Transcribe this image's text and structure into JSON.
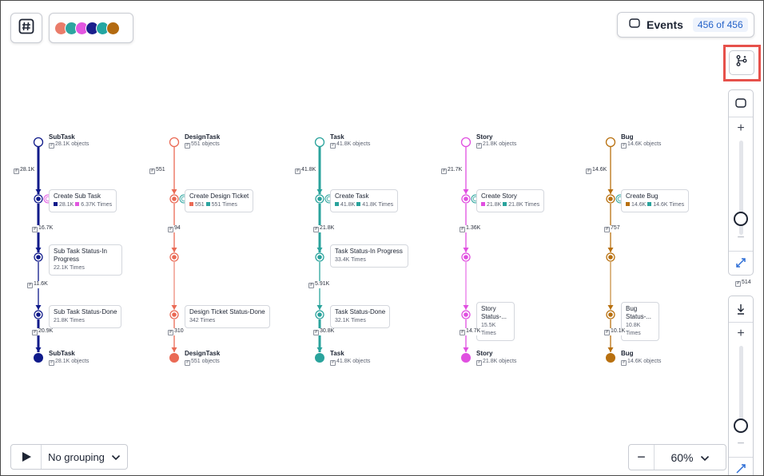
{
  "toolbar": {
    "hash_icon": "hash-icon",
    "palette_colors": [
      "#ea7c6a",
      "#2da5a0",
      "#e256e0",
      "#1a1f8c",
      "#23a6a2",
      "#b36a10"
    ],
    "events_label": "Events",
    "events_count": "456 of 456"
  },
  "side": {
    "count_label": "514"
  },
  "bottom": {
    "grouping_label": "No grouping",
    "zoom_value": "60%",
    "zoom_minus": "−"
  },
  "columns": [
    {
      "name": "SubTask",
      "color": "#0f1a8a",
      "secondary": "#e256e0",
      "start_title": "SubTask",
      "start_sub": "28.1K objects",
      "end_title": "SubTask",
      "end_sub": "28.1K objects",
      "e1": "28.1K",
      "create_title": "Create Sub Task",
      "create_a": "28.1K",
      "create_b": "6.37K Times",
      "e2": "16.7K",
      "s1_title": "Sub Task Status-In Progress",
      "s1_meta": "22.1K Times",
      "e3": "11.6K",
      "s2_title": "Sub Task Status-Done",
      "s2_meta": "21.8K Times",
      "e4": "20.9K"
    },
    {
      "name": "DesignTask",
      "color": "#ea6a55",
      "secondary": "#2da5a0",
      "start_title": "DesignTask",
      "start_sub": "551 objects",
      "end_title": "DesignTask",
      "end_sub": "551 objects",
      "e1": "551",
      "create_title": "Create Design Ticket",
      "create_a": "551",
      "create_b": "551 Times",
      "e2": "94",
      "s1_title": "Design Ticket Status-Done",
      "s1_meta": "342 Times",
      "e4": "310"
    },
    {
      "name": "Task",
      "color": "#2aa39c",
      "secondary": "#2aa39c",
      "start_title": "Task",
      "start_sub": "41.8K objects",
      "end_title": "Task",
      "end_sub": "41.8K objects",
      "e1": "41.8K",
      "create_title": "Create Task",
      "create_a": "41.8K",
      "create_b": "41.8K Times",
      "e2": "21.8K",
      "s1_title": "Task Status-In Progress",
      "s1_meta": "33.4K Times",
      "e3": "5.91K",
      "s2_title": "Task Status-Done",
      "s2_meta": "32.1K Times",
      "e4": "30.8K"
    },
    {
      "name": "Story",
      "color": "#e04fe0",
      "secondary": "#2aa39c",
      "start_title": "Story",
      "start_sub": "21.8K objects",
      "end_title": "Story",
      "end_sub": "21.8K objects",
      "e1": "21.7K",
      "create_title": "Create Story",
      "create_a": "21.8K",
      "create_b": "21.8K Times",
      "e2": "1.36K",
      "s1_title": "Story Status-...",
      "s1_meta": "15.5K Times",
      "e4": "14.7K"
    },
    {
      "name": "Bug",
      "color": "#b8700f",
      "secondary": "#2aa39c",
      "start_title": "Bug",
      "start_sub": "14.6K objects",
      "end_title": "Bug",
      "end_sub": "14.6K objects",
      "e1": "14.6K",
      "create_title": "Create Bug",
      "create_a": "14.6K",
      "create_b": "14.6K Times",
      "e2": "757",
      "s1_title": "Bug Status-...",
      "s1_meta": "10.8K Times",
      "e4": "10.1K"
    }
  ]
}
